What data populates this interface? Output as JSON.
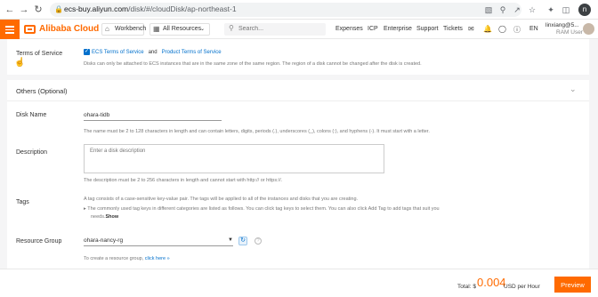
{
  "browser": {
    "url_host": "ecs-buy.aliyun.com",
    "url_path": "/disk/#/cloudDisk/ap-northeast-1",
    "profile_initial": "n"
  },
  "topbar": {
    "logo_text": "Alibaba Cloud",
    "workbench_label": "Workbench",
    "resources_label": "All Resources",
    "search_placeholder": "Search...",
    "nav": [
      "Expenses",
      "ICP",
      "Enterprise",
      "Support",
      "Tickets"
    ],
    "language": "EN",
    "user_name": "linxiang@5...",
    "user_role": "RAM User"
  },
  "terms": {
    "label": "Terms of Service",
    "link1": "ECS Terms of Service",
    "and": "and",
    "link2": "Product Terms of Service",
    "note": "Disks can only be attached to ECS instances that are in the same zone of the same region. The region of a disk cannot be changed after the disk is created."
  },
  "others": {
    "title": "Others (Optional)"
  },
  "disk_name": {
    "label": "Disk Name",
    "value": "ohara-tidb",
    "help": "The name must be 2 to 128 characters in length and can contain letters, digits, periods (.), underscores (_), colons (:), and hyphens (-). It must start with a letter."
  },
  "description": {
    "label": "Description",
    "placeholder": "Enter a disk description",
    "help": "The description must be 2 to 256 characters in length and cannot start with http:// or https://."
  },
  "tags": {
    "label": "Tags",
    "help1": "A tag consists of a case-sensitive key-value pair. The tags will be applied to all of the instances and disks that you are creating.",
    "help2": "The commonly used tag keys in different categories are listed as follows. You can click tag keys to select them. You can also click Add Tag to add tags that suit you",
    "help3": "needs.",
    "show": "Show"
  },
  "resource_group": {
    "label": "Resource Group",
    "value": "ohara-nancy-rg",
    "create_text": "To create a resource group,",
    "create_link": "click here",
    "create_suffix": "»"
  },
  "footer": {
    "total_label": "Total: $",
    "cost": "0.004",
    "unit": "USD per Hour",
    "preview": "Preview"
  },
  "colors": {
    "brand": "#ff6a00",
    "link": "#0070cc"
  }
}
